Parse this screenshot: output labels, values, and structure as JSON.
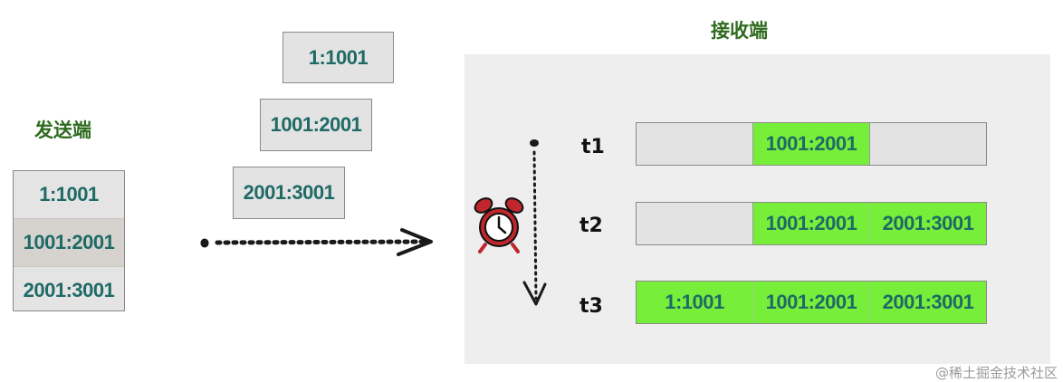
{
  "sender": {
    "title": "发送端",
    "segments": [
      "1:1001",
      "1001:2001",
      "2001:3001"
    ]
  },
  "in_flight": [
    "1:1001",
    "1001:2001",
    "2001:3001"
  ],
  "receiver": {
    "title": "接收端",
    "rows": [
      {
        "label": "t1",
        "segments": [
          {
            "text": "",
            "received": false
          },
          {
            "text": "1001:2001",
            "received": true
          },
          {
            "text": "",
            "received": false
          }
        ]
      },
      {
        "label": "t2",
        "segments": [
          {
            "text": "",
            "received": false
          },
          {
            "text": "1001:2001",
            "received": true
          },
          {
            "text": "2001:3001",
            "received": true
          }
        ]
      },
      {
        "label": "t3",
        "segments": [
          {
            "text": "1:1001",
            "received": true
          },
          {
            "text": "1001:2001",
            "received": true
          },
          {
            "text": "2001:3001",
            "received": true
          }
        ]
      }
    ]
  },
  "icons": {
    "alarm_clock": "alarm-clock-icon",
    "send_arrow": "dotted-arrow-icon",
    "time_arrow": "dotted-down-arrow-icon"
  },
  "colors": {
    "label_green": "#2f6b1f",
    "text_teal": "#1f6a66",
    "received_green": "#77ee3a",
    "box_gray": "#e3e3e3"
  },
  "watermark": "@稀土掘金技术社区"
}
